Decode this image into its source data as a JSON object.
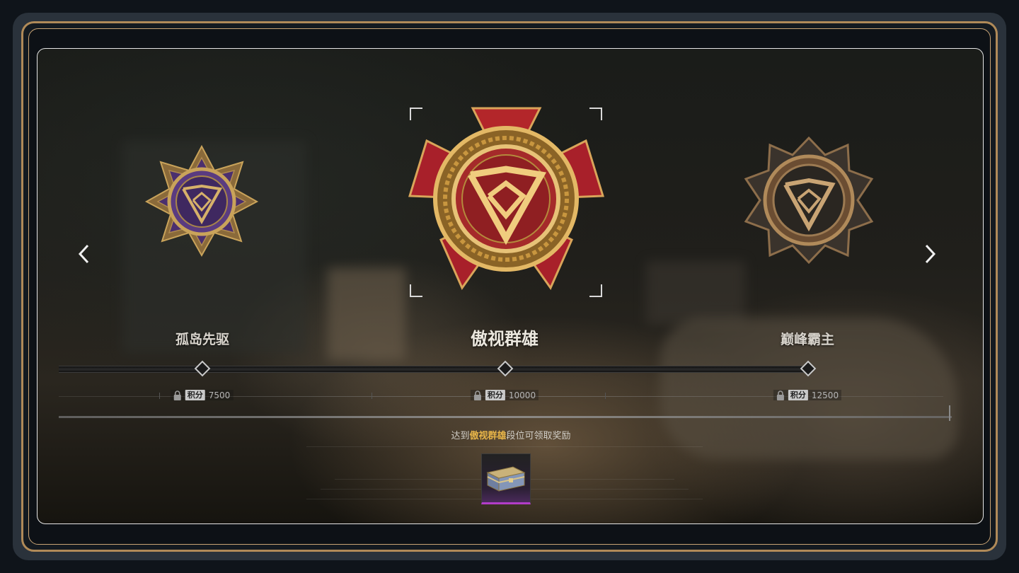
{
  "tiers": [
    {
      "name": "孤岛先驱",
      "score_label": "积分",
      "score": "7500",
      "locked": true
    },
    {
      "name": "傲视群雄",
      "score_label": "积分",
      "score": "10000",
      "locked": true,
      "selected": true
    },
    {
      "name": "巅峰霸主",
      "score_label": "积分",
      "score": "12500",
      "locked": true
    }
  ],
  "reward": {
    "hint_prefix": "达到",
    "hint_highlight": "傲视群雄",
    "hint_suffix": "段位可领取奖励",
    "item_icon": "treasure-chest-icon"
  },
  "colors": {
    "highlight": "#e8b548",
    "frame_gold": "#b08a58",
    "reward_rarity": "#b23dc8",
    "medal_purple": "#4b2f6e",
    "medal_red": "#b3262a",
    "medal_dark": "#2a2621"
  },
  "icons": {
    "prev": "chevron-left-icon",
    "next": "chevron-right-icon",
    "lock": "lock-icon"
  }
}
